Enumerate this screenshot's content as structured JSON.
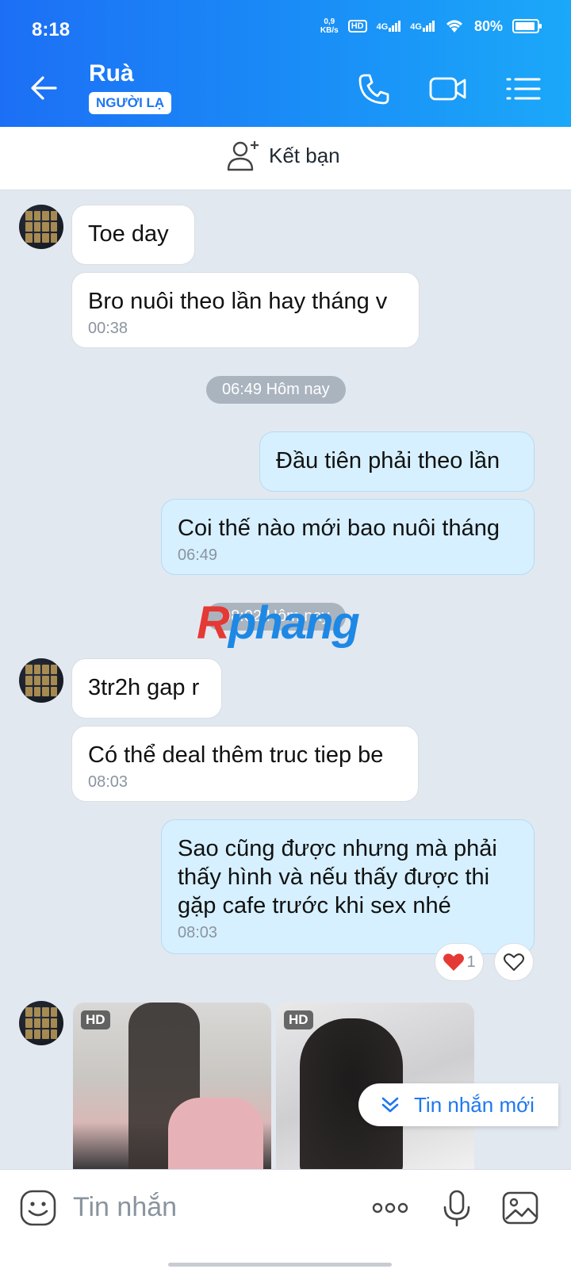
{
  "status": {
    "time": "8:18",
    "netspeed_top": "0,9",
    "netspeed_bottom": "KB/s",
    "hd": "HD",
    "net1": "4G",
    "net2": "4G",
    "battery": "80%"
  },
  "header": {
    "title": "Ruà",
    "badge": "NGƯỜI LẠ"
  },
  "addfriend": {
    "label": "Kết bạn"
  },
  "messages": [
    {
      "dir": "in",
      "text": "Toe day",
      "time": ""
    },
    {
      "dir": "in",
      "text": "Bro nuôi theo lần hay tháng v",
      "time": "00:38"
    },
    {
      "dir": "out",
      "text": "Đầu tiên phải theo lần",
      "time": ""
    },
    {
      "dir": "out",
      "text": "Coi thế nào mới bao nuôi tháng",
      "time": "06:49"
    },
    {
      "dir": "in",
      "text": "3tr2h gap r",
      "time": ""
    },
    {
      "dir": "in",
      "text": "Có thể deal thêm truc tiep be",
      "time": "08:03"
    },
    {
      "dir": "out",
      "text": "Sao cũng được nhưng mà phải thấy hình và nếu thấy được thi gặp cafe trước khi sex nhé",
      "time": "08:03"
    }
  ],
  "dividers": [
    "06:49 Hôm nay",
    "08:02 Hôm nay"
  ],
  "reaction": {
    "count": "1"
  },
  "photos": [
    {
      "badge": "HD"
    },
    {
      "badge": "HD"
    }
  ],
  "new_messages": "Tin nhắn mới",
  "composer": {
    "placeholder": "Tin nhắn"
  },
  "watermark": {
    "part1": "R",
    "part2": "phang"
  },
  "colors": {
    "header_start": "#1c6ff5",
    "header_end": "#1ba8f9",
    "accent": "#1d77f2",
    "out_bubble": "#d6f0ff"
  }
}
